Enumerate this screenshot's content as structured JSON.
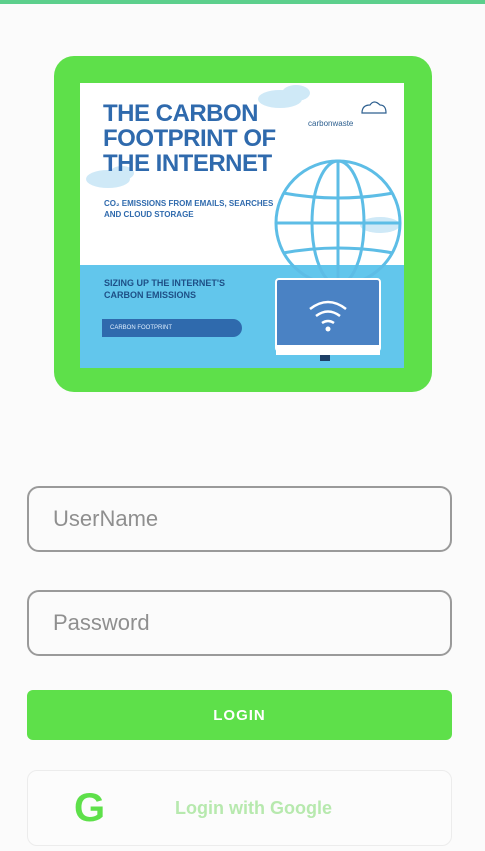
{
  "banner": {
    "title": "THE CARBON FOOTPRINT OF THE INTERNET",
    "subtitle": "CO₂ EMISSIONS FROM EMAILS, SEARCHES AND CLOUD STORAGE",
    "brand": "carbonwaste",
    "section_heading": "SIZING UP THE INTERNET'S CARBON EMISSIONS",
    "pill_label": "CARBON FOOTPRINT"
  },
  "form": {
    "username_placeholder": "UserName",
    "username_value": "",
    "password_placeholder": "Password",
    "password_value": "",
    "login_label": "LOGIN",
    "google_label": "Login with Google",
    "google_icon_glyph": "G"
  },
  "colors": {
    "accent": "#5ee04a",
    "poster_blue": "#2f6aad",
    "poster_sky": "#62c6ec",
    "top_bar": "#5ccf8c"
  }
}
